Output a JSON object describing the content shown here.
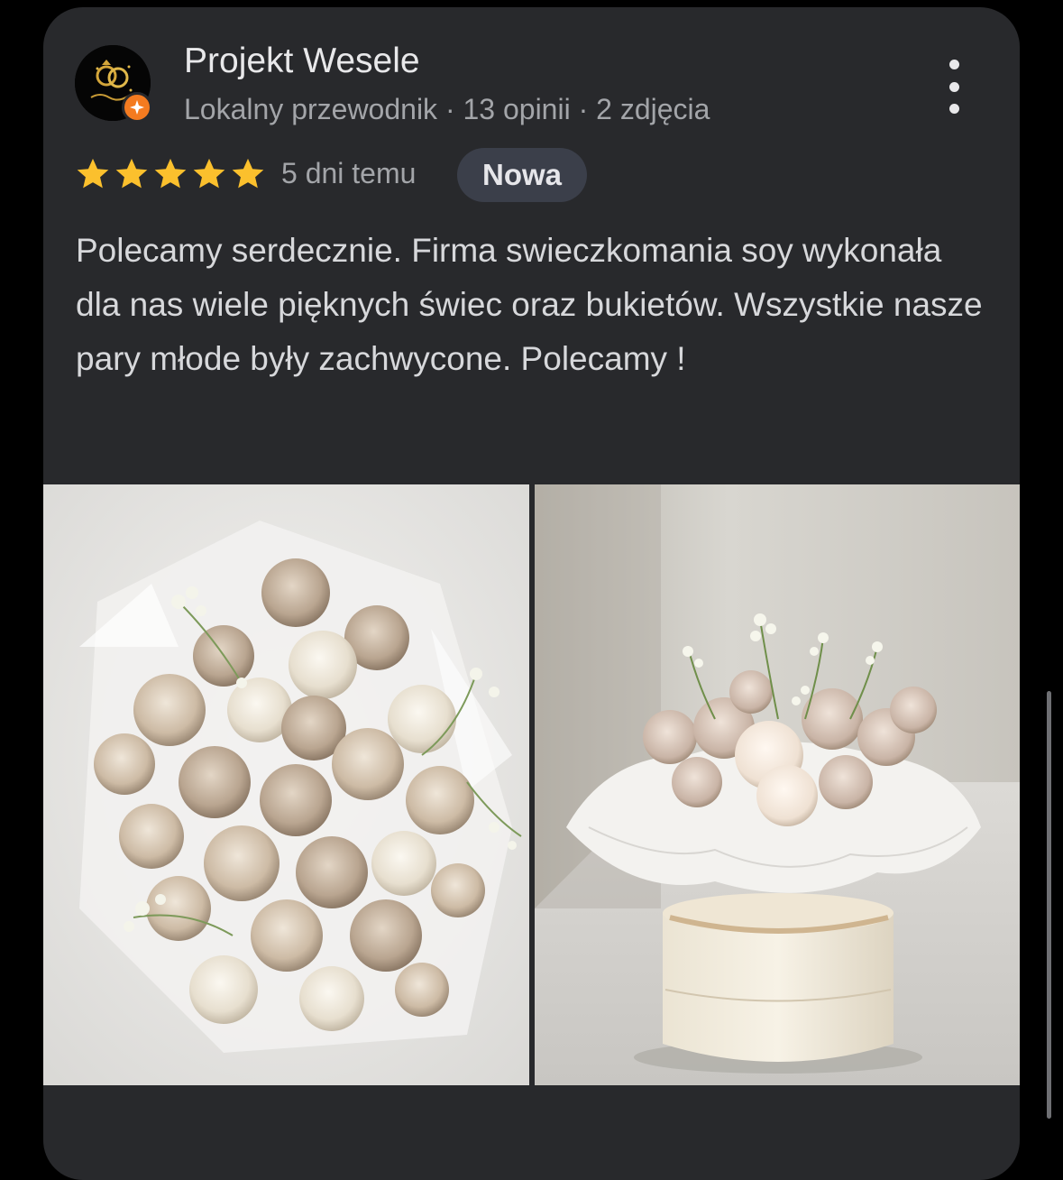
{
  "reviewer": {
    "name": "Projekt Wesele",
    "meta": "Lokalny przewodnik · 13 opinii · 2 zdjęcia",
    "avatar_icon": "rings-logo-avatar",
    "badge_icon": "local-guide-badge-icon",
    "badge_color": "#f47b20"
  },
  "rating": {
    "stars": 5,
    "max": 5,
    "star_color": "#fbc02d"
  },
  "time_ago": "5 dni temu",
  "chip": "Nowa",
  "review_text": "Polecamy serdecznie. Firma swieczkomania soy wykonała dla nas wiele pięknych świec oraz bukietów. Wszystkie nasze pary młode były zachwycone. Polecamy !",
  "photos": [
    {
      "name": "bouquet-photo"
    },
    {
      "name": "flower-box-photo"
    }
  ],
  "menu_icon": "more-vertical-icon",
  "colors": {
    "background": "#000000",
    "card": "#28292c",
    "primary_text": "#e8e8ea",
    "secondary_text": "#a3a5a9",
    "chip_bg": "#3b3f4a"
  }
}
